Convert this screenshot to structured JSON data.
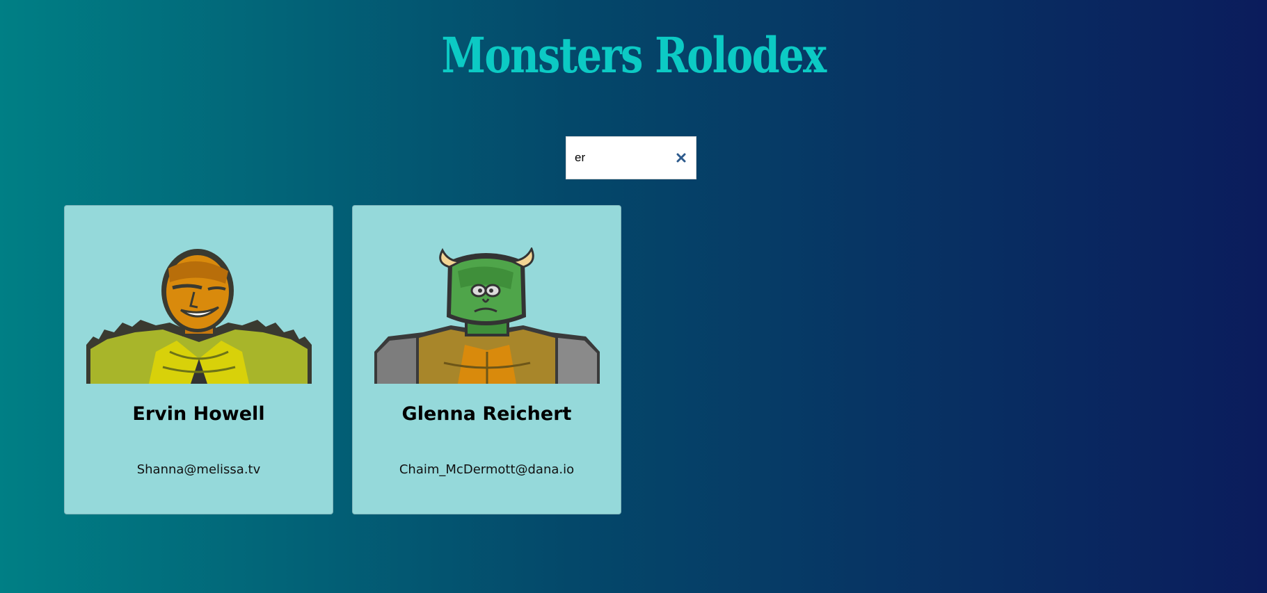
{
  "app": {
    "title": "Monsters Rolodex"
  },
  "search": {
    "value": "er",
    "clear_icon": "close-icon"
  },
  "monsters": [
    {
      "name": "Ervin Howell",
      "email": "Shanna@melissa.tv",
      "image_icon": "monster-avatar-spiky-yellow"
    },
    {
      "name": "Glenna Reichert",
      "email": "Chaim_McDermott@dana.io",
      "image_icon": "monster-avatar-horned-green"
    }
  ],
  "colors": {
    "title": "#0ccac4",
    "card_background": "#95d9da",
    "gradient_start": "#007f85",
    "gradient_end": "#0b1c5c",
    "clear_icon": "#2d5a8c"
  }
}
